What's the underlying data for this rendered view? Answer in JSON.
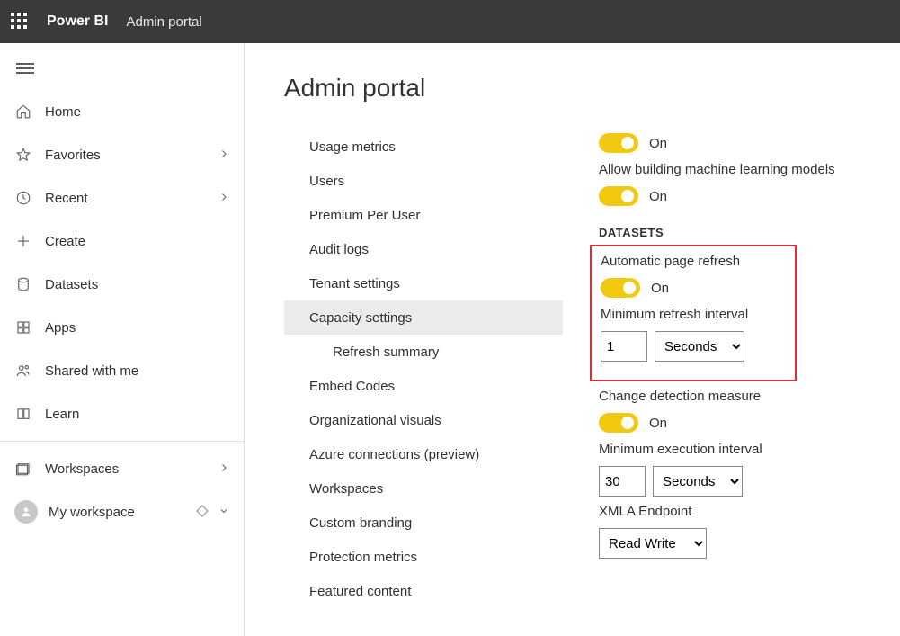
{
  "topbar": {
    "brand": "Power BI",
    "pagetitle": "Admin portal"
  },
  "sidebar": {
    "items": [
      {
        "key": "home",
        "label": "Home"
      },
      {
        "key": "favorites",
        "label": "Favorites",
        "chevron": true
      },
      {
        "key": "recent",
        "label": "Recent",
        "chevron": true
      },
      {
        "key": "create",
        "label": "Create"
      },
      {
        "key": "datasets",
        "label": "Datasets"
      },
      {
        "key": "apps",
        "label": "Apps"
      },
      {
        "key": "shared",
        "label": "Shared with me"
      },
      {
        "key": "learn",
        "label": "Learn"
      }
    ],
    "workspaces_label": "Workspaces",
    "my_workspace_label": "My workspace"
  },
  "page": {
    "title": "Admin portal"
  },
  "subnav": {
    "items": [
      "Usage metrics",
      "Users",
      "Premium Per User",
      "Audit logs",
      "Tenant settings",
      "Capacity settings",
      "Refresh summary",
      "Embed Codes",
      "Organizational visuals",
      "Azure connections (preview)",
      "Workspaces",
      "Custom branding",
      "Protection metrics",
      "Featured content"
    ]
  },
  "settings": {
    "firstToggle": "On",
    "ml_label": "Allow building machine learning models",
    "mlToggle": "On",
    "datasets_header": "DATASETS",
    "apr_label": "Automatic page refresh",
    "aprToggle": "On",
    "min_refresh_label": "Minimum refresh interval",
    "min_refresh_value": "1",
    "min_refresh_unit": "Seconds",
    "cdm_label": "Change detection measure",
    "cdmToggle": "On",
    "min_exec_label": "Minimum execution interval",
    "min_exec_value": "30",
    "min_exec_unit": "Seconds",
    "xmla_label": "XMLA Endpoint",
    "xmla_value": "Read Write"
  }
}
